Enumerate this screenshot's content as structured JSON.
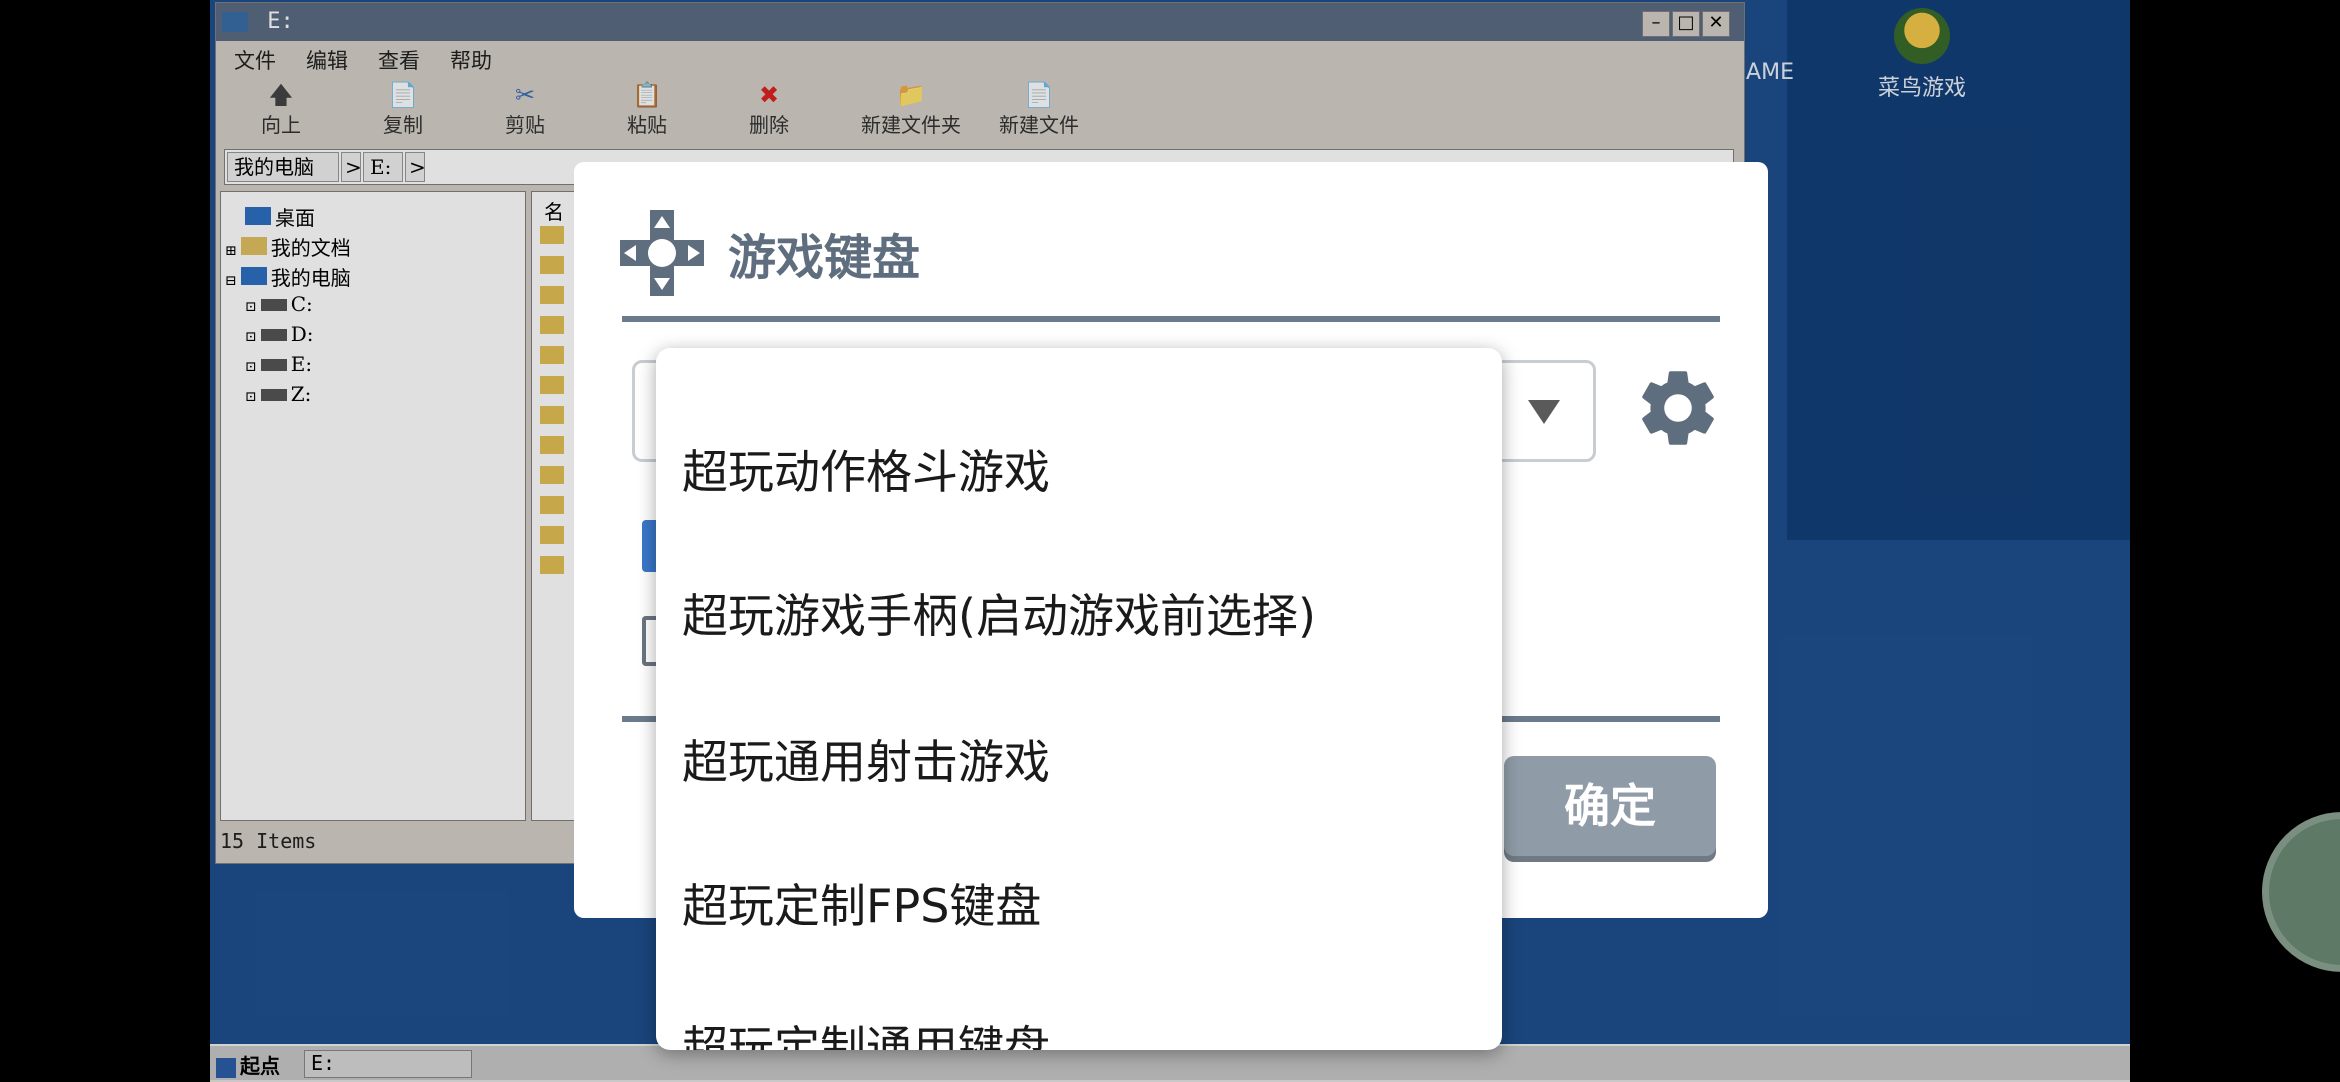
{
  "window": {
    "title": "E:",
    "min_label": "–",
    "max_label": "□",
    "close_label": "✕"
  },
  "menu": [
    "文件",
    "编辑",
    "查看",
    "帮助"
  ],
  "toolbar": [
    {
      "label": "向上",
      "icon": "arrow-up-icon",
      "glyph": "🡅"
    },
    {
      "label": "复制",
      "icon": "copy-icon",
      "glyph": "📄"
    },
    {
      "label": "剪贴",
      "icon": "cut-icon",
      "glyph": "✂"
    },
    {
      "label": "粘贴",
      "icon": "paste-icon",
      "glyph": "📋"
    },
    {
      "label": "删除",
      "icon": "delete-icon",
      "glyph": "✖"
    },
    {
      "label": "新建文件夹",
      "icon": "new-folder-icon",
      "glyph": "📁"
    },
    {
      "label": "新建文件",
      "icon": "new-file-icon",
      "glyph": "📄"
    }
  ],
  "address": {
    "crumbs": [
      "我的电脑",
      ">",
      "E:",
      ">"
    ]
  },
  "tree": {
    "nodes": [
      "桌面",
      "我的文档",
      "我的电脑",
      "C:",
      "D:",
      "E:",
      "Z:"
    ]
  },
  "filelist": {
    "header": "名"
  },
  "status": {
    "items": "15 Items"
  },
  "desktop": {
    "game_label": "菜鸟游戏",
    "partial_label": "AME"
  },
  "taskbar": {
    "start": "起点",
    "task": "E:"
  },
  "dialog": {
    "title": "游戏键盘",
    "ok": "确定"
  },
  "dropdown": {
    "options": [
      "超玩动作格斗游戏",
      "超玩游戏手柄(启动游戏前选择)",
      "超玩通用射击游戏",
      "超玩定制FPS键盘",
      "超玩定制通用键盘"
    ]
  },
  "colors": {
    "dialog_accent": "#5f6e7e",
    "ok_button": "#8f9ba6",
    "checkbox_checked": "#3a77c8"
  }
}
